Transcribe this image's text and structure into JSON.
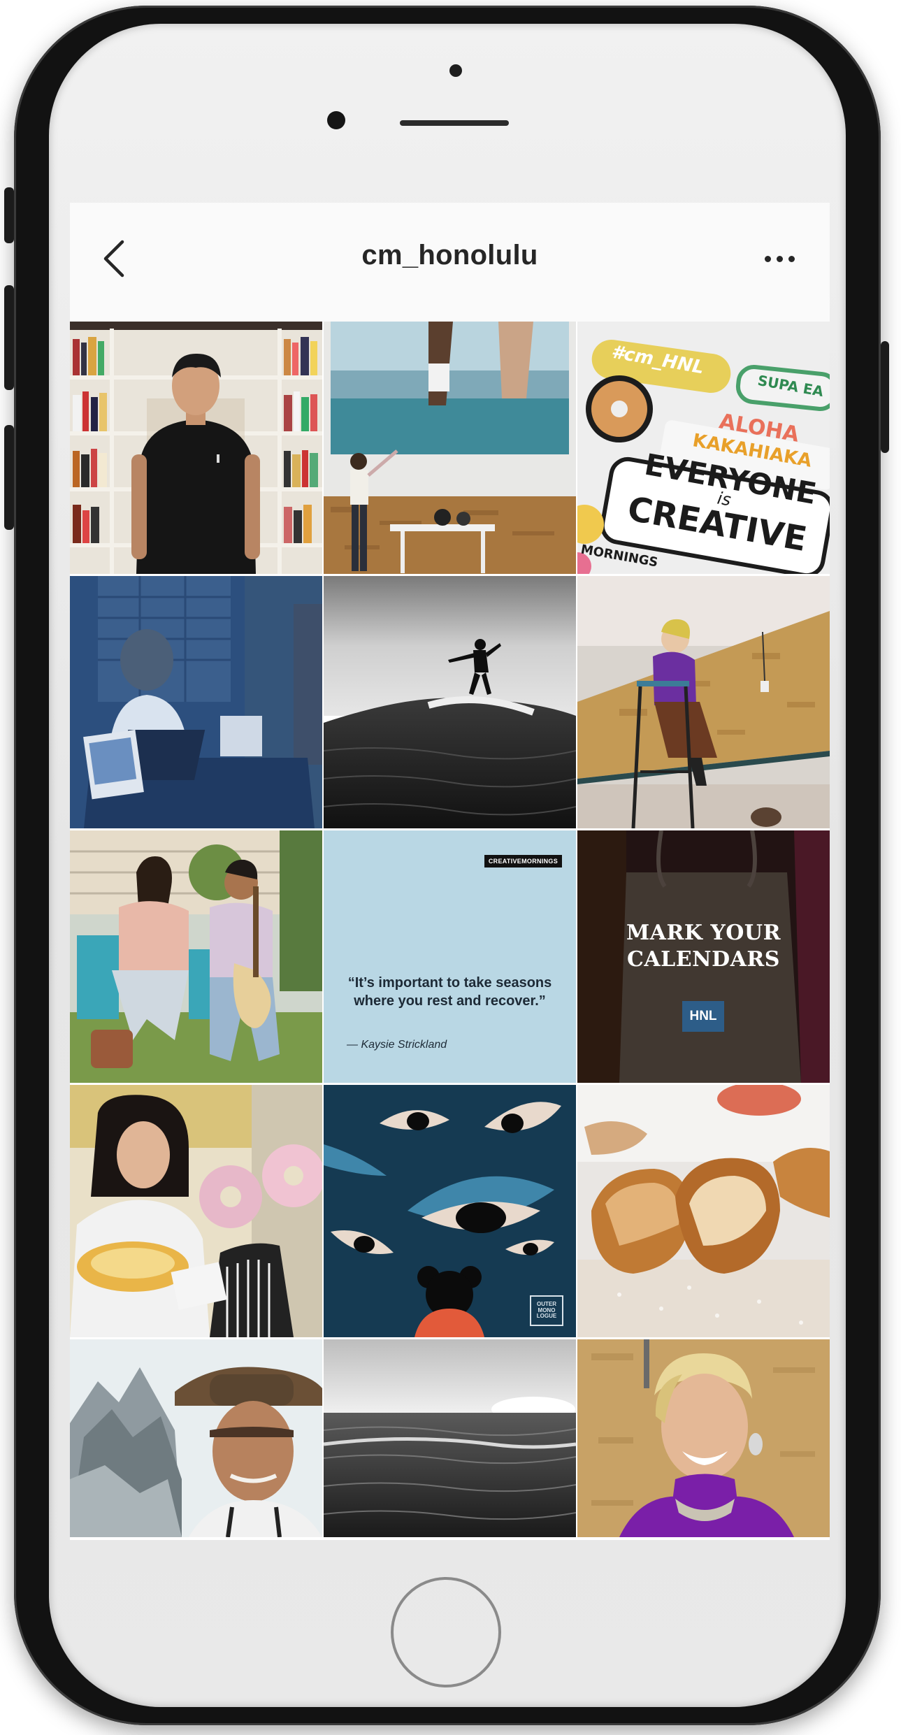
{
  "navbar": {
    "title": "cm_honolulu",
    "back_icon": "chevron-left-icon",
    "more_icon": "ellipsis-icon"
  },
  "grid": {
    "quote": {
      "text": "“It’s important to take seasons where you rest and recover.”",
      "author": "— Kaysie Strickland",
      "badge": "CREATIVEMORNINGS"
    },
    "calendar": {
      "headline": "MARK YOUR CALENDARS",
      "badge": "HNL"
    },
    "stickers": {
      "line1": "EVERYONE",
      "line2": "is",
      "line3": "CREATIVE",
      "tag1": "#cm_HNL",
      "tag2": "SUPA EA",
      "tag3": "ALOHA",
      "tag4": "KAKAHIAKA",
      "tag5": "MORNINGS"
    },
    "outer_monologue": "OUTER MONO LOGUE"
  },
  "colors": {
    "nav_bg": "#fafafa",
    "quote_bg": "#b9d7e4",
    "monologue_bg": "#153a52",
    "hnl_blue": "#2d5d88"
  }
}
